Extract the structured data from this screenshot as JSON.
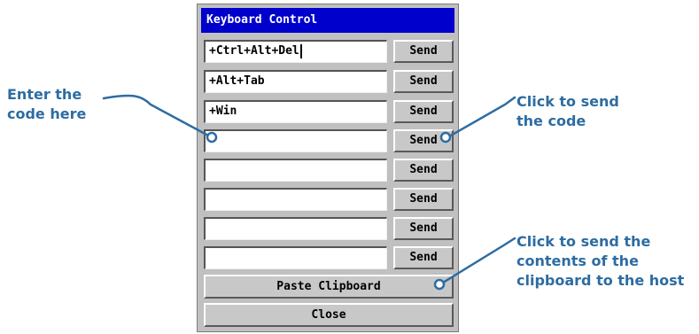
{
  "dialog": {
    "title": "Keyboard Control",
    "rows": [
      {
        "value": "+Ctrl+Alt+Del",
        "button": "Send"
      },
      {
        "value": "+Alt+Tab",
        "button": "Send"
      },
      {
        "value": "+Win",
        "button": "Send"
      },
      {
        "value": "",
        "button": "Send"
      },
      {
        "value": "",
        "button": "Send"
      },
      {
        "value": "",
        "button": "Send"
      },
      {
        "value": "",
        "button": "Send"
      },
      {
        "value": "",
        "button": "Send"
      }
    ],
    "paste_label": "Paste Clipboard",
    "close_label": "Close"
  },
  "callouts": {
    "enter_code": [
      "Enter the",
      "code here"
    ],
    "send_code": [
      "Click to send",
      "the code"
    ],
    "send_clipboard": [
      "Click to send the",
      "contents of the",
      "clipboard to the host"
    ]
  },
  "colors": {
    "titlebar": "#0000cc",
    "callout": "#2d6ca2",
    "dialog_bg": "#c0c0c0"
  }
}
